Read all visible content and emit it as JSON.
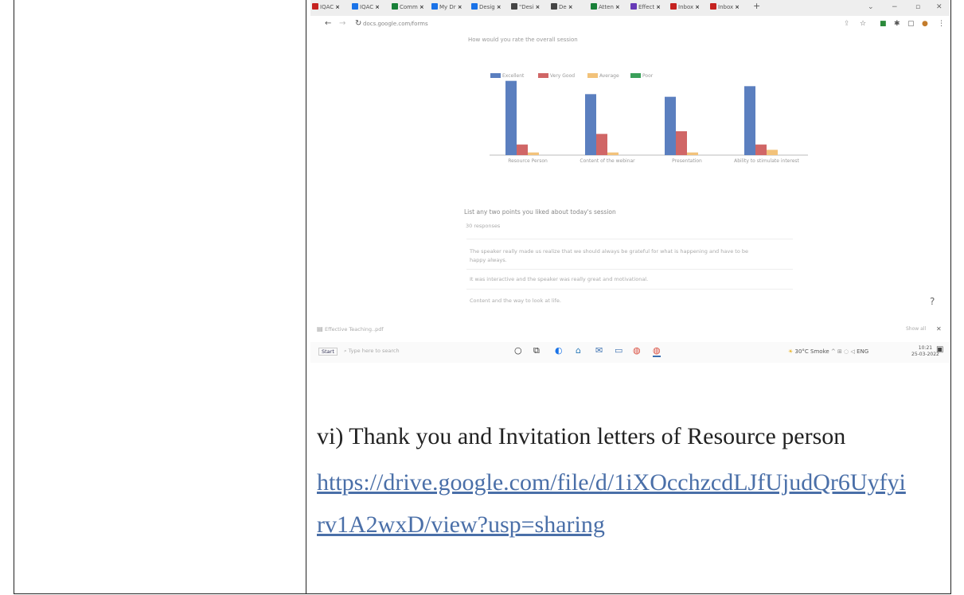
{
  "browser": {
    "tabs": [
      {
        "label": "IQAC",
        "icon": "gmail-icon",
        "color": "#c5221f"
      },
      {
        "label": "IQAC",
        "icon": "drive-icon",
        "color": "#1a73e8"
      },
      {
        "label": "Comm",
        "icon": "sheets-icon",
        "color": "#188038"
      },
      {
        "label": "My Dr",
        "icon": "drive-icon",
        "color": "#1a73e8"
      },
      {
        "label": "Desig",
        "icon": "drive-icon",
        "color": "#1a73e8"
      },
      {
        "label": "\"Desi",
        "icon": "doc-icon",
        "color": "#444444"
      },
      {
        "label": "De",
        "icon": "doc-icon",
        "color": "#444444"
      },
      {
        "label": "Atten",
        "icon": "sheets-icon",
        "color": "#188038"
      },
      {
        "label": "Effect",
        "icon": "forms-icon",
        "color": "#673ab7"
      },
      {
        "label": "Inbox",
        "icon": "gmail-icon",
        "color": "#c5221f"
      },
      {
        "label": "Inbox",
        "icon": "gmail-icon",
        "color": "#c5221f"
      }
    ],
    "new_tab": "+",
    "url": "docs.google.com/forms"
  },
  "form": {
    "question1": "How would you rate the overall session",
    "question2": "List any two points you liked about today's session",
    "responses_count": "30 responses",
    "responses": [
      "The speaker really made us realize that we should always be grateful for what is happening and have to be",
      "happy always.",
      "It was interactive and the speaker was really great and motivational.",
      "Content and the way to look at life."
    ]
  },
  "chart_data": {
    "type": "bar",
    "title": "",
    "categories": [
      "Resource Person",
      "Content of the webinar",
      "Presentation",
      "Ability to stimulate interest"
    ],
    "series": [
      {
        "name": "Excellent",
        "values": [
          28,
          23,
          22,
          26
        ],
        "color": "#5b7fbf"
      },
      {
        "name": "Very Good",
        "values": [
          4,
          8,
          9,
          4
        ],
        "color": "#d06666"
      },
      {
        "name": "Average",
        "values": [
          1,
          1,
          1,
          2
        ],
        "color": "#f2c27a"
      },
      {
        "name": "Poor",
        "values": [
          0,
          0,
          0,
          0
        ],
        "color": "#3aa05a"
      }
    ],
    "ylim": [
      0,
      30
    ],
    "legend_position": "top-left"
  },
  "download_bar": {
    "file": "Effective Teaching..pdf",
    "show_all": "Show all"
  },
  "taskbar": {
    "start": "Start",
    "search_placeholder": "Type here to search",
    "weather": "30°C Smoke",
    "lang": "ENG",
    "time": "10:21",
    "date": "25-03-2022"
  },
  "document": {
    "heading": "vi) Thank you and Invitation letters of Resource person",
    "link_line1": "https://drive.google.com/file/d/1iXOcchzcdLJfUjudQr6Uyfyi",
    "link_line2": "rv1A2wxD/view?usp=sharing"
  }
}
